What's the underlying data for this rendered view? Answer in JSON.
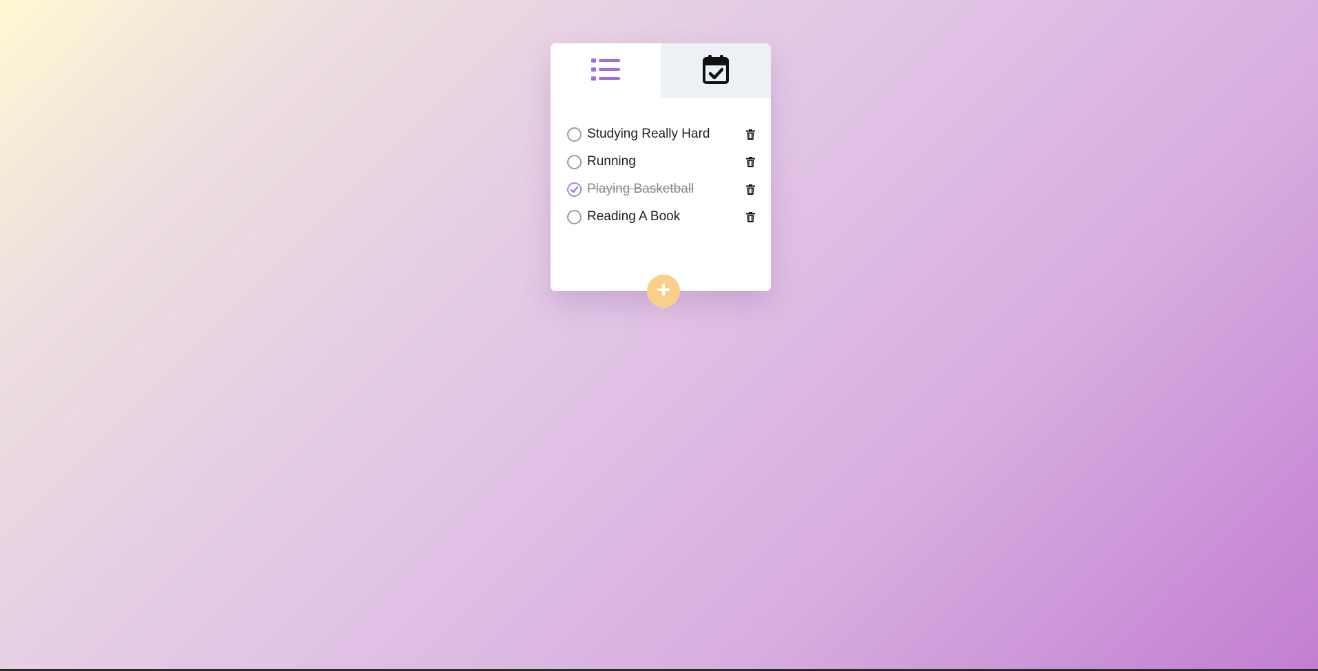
{
  "tabs": [
    {
      "name": "list",
      "icon": "list-icon",
      "active": true,
      "color": "#9b6ee0"
    },
    {
      "name": "calendar",
      "icon": "calendar-check-icon",
      "active": false,
      "color": "#111111"
    }
  ],
  "todos": [
    {
      "label": "Studying Really Hard",
      "done": false
    },
    {
      "label": "Running",
      "done": false
    },
    {
      "label": "Playing Basketball",
      "done": true
    },
    {
      "label": "Reading A Book",
      "done": false
    }
  ],
  "icons": {
    "delete": "trash-icon",
    "add": "plus-icon",
    "check": "check-icon"
  },
  "colors": {
    "accent": "#9b6ee0",
    "add_button": "#f8d08b",
    "tab_inactive_bg": "#edf1f5",
    "done_text": "#8a8a8a"
  }
}
